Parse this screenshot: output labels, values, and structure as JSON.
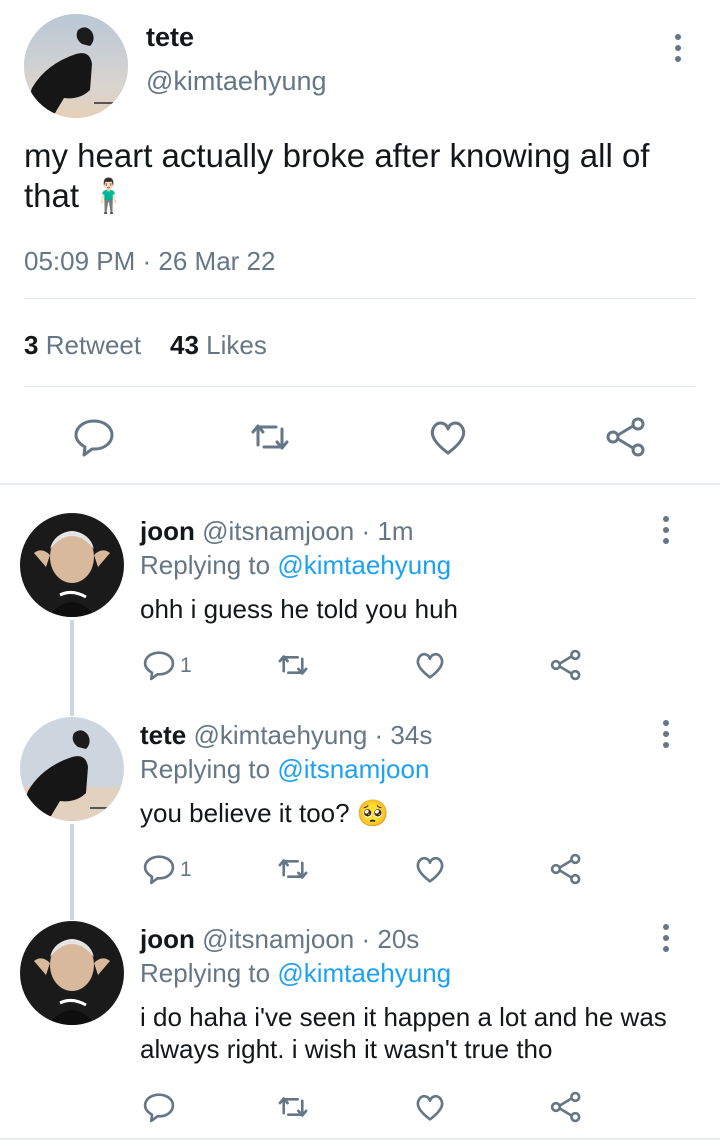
{
  "main_tweet": {
    "display_name": "tete",
    "handle": "@kimtaehyung",
    "text": "my heart actually broke after knowing all of that 🧍🏻‍♂️",
    "time": "05:09 PM",
    "date": "26 Mar 22",
    "retweets_count": "3",
    "retweets_label": "Retweet",
    "likes_count": "43",
    "likes_label": "Likes"
  },
  "replies": [
    {
      "display_name": "joon",
      "handle": "@itsnamjoon",
      "age": "1m",
      "replying_prefix": "Replying to",
      "replying_to": "@kimtaehyung",
      "text": "ohh i guess he told you huh",
      "reply_count": "1"
    },
    {
      "display_name": "tete",
      "handle": "@kimtaehyung",
      "age": "34s",
      "replying_prefix": "Replying to",
      "replying_to": "@itsnamjoon",
      "text": "you believe it too? 🥺",
      "reply_count": "1"
    },
    {
      "display_name": "joon",
      "handle": "@itsnamjoon",
      "age": "20s",
      "replying_prefix": "Replying to",
      "replying_to": "@kimtaehyung",
      "text": "i do haha i've seen it happen a lot and he was always right. i wish it wasn't true tho",
      "reply_count": ""
    }
  ],
  "icons": {
    "reply": "reply-icon",
    "retweet": "retweet-icon",
    "like": "heart-icon",
    "share": "share-icon",
    "more": "more-vertical-icon"
  },
  "colors": {
    "text": "#14171a",
    "secondary": "#657786",
    "link": "#1da1f2",
    "divider": "#e1e8ed"
  }
}
